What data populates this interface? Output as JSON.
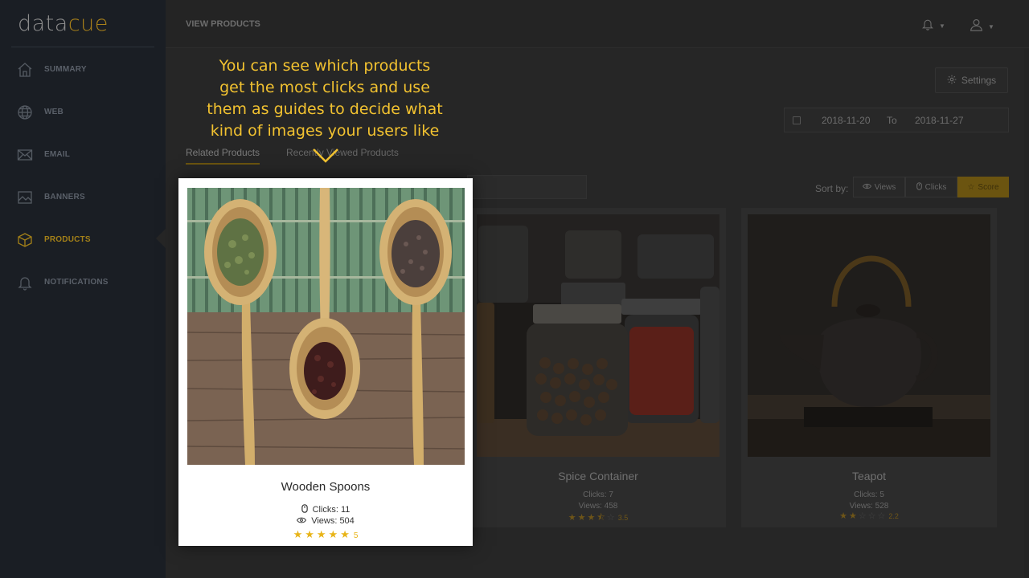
{
  "brand": {
    "part1": "data",
    "part2": "cue"
  },
  "sidebar": {
    "items": [
      {
        "label": "SUMMARY",
        "icon": "home-icon"
      },
      {
        "label": "WEB",
        "icon": "globe-icon"
      },
      {
        "label": "EMAIL",
        "icon": "envelope-icon"
      },
      {
        "label": "BANNERS",
        "icon": "image-icon"
      },
      {
        "label": "PRODUCTS",
        "icon": "box-icon",
        "active": true
      },
      {
        "label": "NOTIFICATIONS",
        "icon": "bell-icon"
      }
    ]
  },
  "header": {
    "title": "VIEW PRODUCTS"
  },
  "settings": {
    "label": "Settings"
  },
  "date_range": {
    "from": "2018-11-20",
    "to_label": "To",
    "to": "2018-11-27"
  },
  "tabs": [
    {
      "label": "Related Products",
      "active": true
    },
    {
      "label": "Recently Viewed Products",
      "active": false
    }
  ],
  "sort": {
    "label": "Sort by:",
    "options": [
      {
        "label": "Views"
      },
      {
        "label": "Clicks"
      },
      {
        "label": "Score",
        "active": true
      }
    ]
  },
  "callout": {
    "lines": [
      "You can see which products",
      "get the most clicks and use",
      "them as guides to decide what",
      "kind of images your users like"
    ]
  },
  "products": [
    {
      "name": "Wooden Spoons",
      "clicks": "Clicks: 11",
      "views": "Views: 504",
      "rating": 5,
      "rating_text": "5",
      "highlighted": true
    },
    {
      "name": "Spice Container",
      "clicks": "Clicks: 7",
      "views": "Views: 458",
      "rating": 3.5,
      "rating_text": "3.5"
    },
    {
      "name": "Teapot",
      "clicks": "Clicks: 5",
      "views": "Views: 528",
      "rating": 2.2,
      "rating_text": "2.2"
    }
  ],
  "colors": {
    "accent": "#f2c230",
    "star": "#e8b418",
    "sidebar_bg": "#1a1e24",
    "overlay_bg": "#262626"
  }
}
